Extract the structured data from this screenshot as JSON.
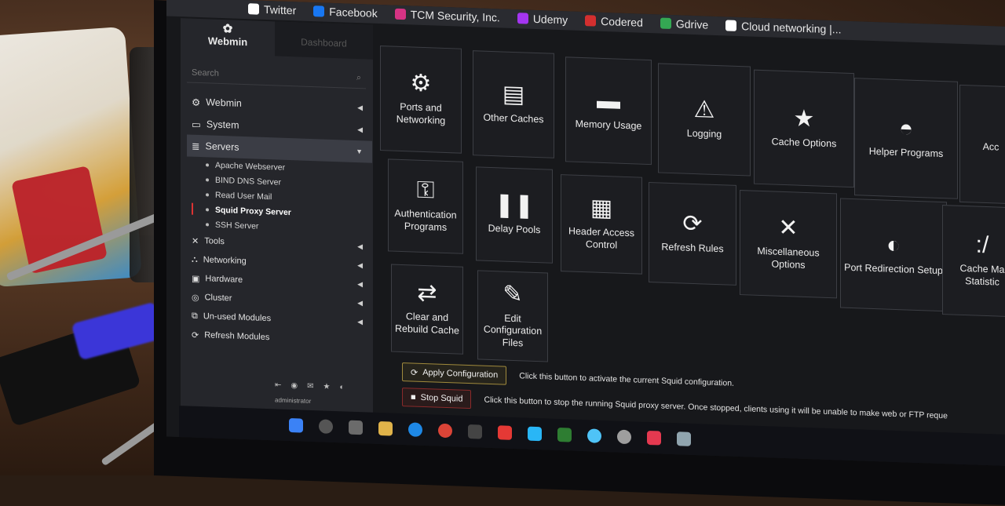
{
  "bookmarks": [
    {
      "label": "Twitter",
      "icon": "x-icon",
      "color": "#ffffff"
    },
    {
      "label": "Facebook",
      "icon": "facebook-icon",
      "color": "#1877f2"
    },
    {
      "label": "TCM Security, Inc.",
      "icon": "tcm-icon",
      "color": "#d63384"
    },
    {
      "label": "Udemy",
      "icon": "udemy-icon",
      "color": "#a435f0"
    },
    {
      "label": "Codered",
      "icon": "codered-icon",
      "color": "#d32f2f"
    },
    {
      "label": "Gdrive",
      "icon": "gdrive-icon",
      "color": "#34a853"
    },
    {
      "label": "Cloud networking |...",
      "icon": "google-icon",
      "color": "#ffffff"
    }
  ],
  "sidebar": {
    "brand": "Webmin",
    "dashboard_tab": "Dashboard",
    "search_placeholder": "Search",
    "menu": [
      {
        "label": "Webmin",
        "icon": "gear-icon"
      },
      {
        "label": "System",
        "icon": "monitor-icon"
      },
      {
        "label": "Servers",
        "icon": "servers-icon"
      }
    ],
    "servers_sub": [
      "Apache Webserver",
      "BIND DNS Server",
      "Read User Mail",
      "Squid Proxy Server",
      "SSH Server"
    ],
    "menu2": [
      {
        "label": "Tools",
        "icon": "tools-icon"
      },
      {
        "label": "Networking",
        "icon": "networking-icon"
      },
      {
        "label": "Hardware",
        "icon": "hardware-icon"
      },
      {
        "label": "Cluster",
        "icon": "cluster-icon"
      },
      {
        "label": "Un-used Modules",
        "icon": "unused-icon"
      },
      {
        "label": "Refresh Modules",
        "icon": "refresh-icon"
      }
    ],
    "user": "administrator"
  },
  "tiles": [
    {
      "label": "Ports and Networking",
      "glyph": "⚙"
    },
    {
      "label": "Other Caches",
      "glyph": "▤"
    },
    {
      "label": "Memory Usage",
      "glyph": "▬"
    },
    {
      "label": "Logging",
      "glyph": "⚠"
    },
    {
      "label": "Cache Options",
      "glyph": "★"
    },
    {
      "label": "Helper Programs",
      "glyph": "◓"
    },
    {
      "label": "Acc",
      "glyph": ""
    },
    {
      "label": "Authentication Programs",
      "glyph": "⚿"
    },
    {
      "label": "Delay Pools",
      "glyph": "❚❚"
    },
    {
      "label": "Header Access Control",
      "glyph": "▦"
    },
    {
      "label": "Refresh Rules",
      "glyph": "⟳"
    },
    {
      "label": "Miscellaneous Options",
      "glyph": "✕"
    },
    {
      "label": "Port Redirection Setup",
      "glyph": "◐"
    },
    {
      "label": "Cache Ma Statistic",
      "glyph": ":/"
    },
    {
      "label": "Clear and Rebuild Cache",
      "glyph": "⇄"
    },
    {
      "label": "Edit Configuration Files",
      "glyph": "✎"
    }
  ],
  "actions": {
    "apply_label": "Apply Configuration",
    "apply_hint": "Click this button to activate the current Squid configuration.",
    "stop_label": "Stop Squid",
    "stop_hint": "Click this button to stop the running Squid proxy server. Once stopped, clients using it will be unable to make web or FTP reque"
  }
}
